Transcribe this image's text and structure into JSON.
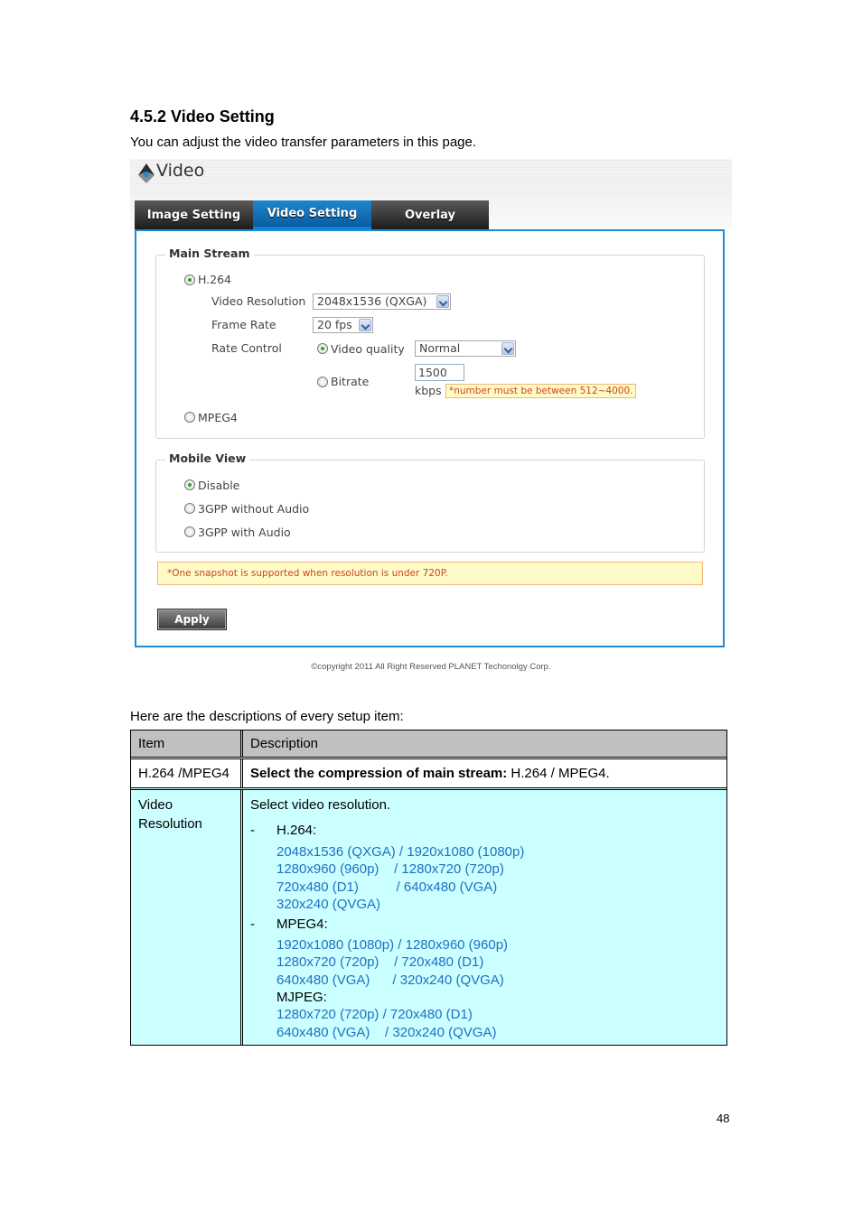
{
  "section": {
    "heading": "4.5.2 Video Setting",
    "intro": "You can adjust the video transfer parameters in this page."
  },
  "screenshot": {
    "app_title": "Video",
    "logo_icon": "planet-logo-icon",
    "tabs": [
      {
        "label": "Image Setting",
        "active": false
      },
      {
        "label": "Video Setting",
        "active": true
      },
      {
        "label": "Overlay",
        "active": false
      }
    ],
    "main_stream": {
      "legend": "Main Stream",
      "h264_label": "H.264",
      "h264_selected": true,
      "video_resolution_label": "Video Resolution",
      "video_resolution_value": "2048x1536 (QXGA)",
      "frame_rate_label": "Frame Rate",
      "frame_rate_value": "20 fps",
      "rate_control_label": "Rate Control",
      "video_quality_label": "Video quality",
      "video_quality_selected": true,
      "video_quality_value": "Normal",
      "bitrate_label": "Bitrate",
      "bitrate_selected": false,
      "bitrate_value": "1500",
      "bitrate_unit": "kbps",
      "bitrate_hint": "*number must be between 512~4000.",
      "mpeg4_label": "MPEG4",
      "mpeg4_selected": false
    },
    "mobile_view": {
      "legend": "Mobile View",
      "options": [
        {
          "label": "Disable",
          "selected": true
        },
        {
          "label": "3GPP without Audio",
          "selected": false
        },
        {
          "label": "3GPP with Audio",
          "selected": false
        }
      ]
    },
    "snapshot_note": "*One snapshot is supported when resolution is under 720P.",
    "apply_label": "Apply",
    "copyright": "©copyright 2011 All Right Reserved PLANET Techonolgy Corp.",
    "colors": {
      "accent": "#1e8ad6",
      "warning_text": "#d0441a",
      "warning_bg": "#fffbc8"
    }
  },
  "descriptions_lead": "Here are the descriptions of every setup item:",
  "table": {
    "headers": [
      "Item",
      "Description"
    ],
    "rows": [
      {
        "item": "H.264 /MPEG4",
        "desc_bold": "Select the compression of main stream:",
        "desc_rest": " H.264 / MPEG4."
      },
      {
        "item_lines": [
          "Video",
          "Resolution"
        ],
        "desc_intro": "Select video resolution.",
        "h264_label": "H.264:",
        "h264_lines": [
          "2048x1536 (QXGA) / 1920x1080 (1080p)",
          "1280x960 (960p)    / 1280x720 (720p)",
          "720x480 (D1)          / 640x480 (VGA)",
          "320x240 (QVGA)"
        ],
        "mpeg4_label": "MPEG4:",
        "mpeg4_lines": [
          "1920x1080 (1080p) / 1280x960 (960p)",
          "1280x720 (720p)    / 720x480 (D1)",
          "640x480 (VGA)      / 320x240 (QVGA)"
        ],
        "mjpeg_label": "MJPEG:",
        "mjpeg_lines": [
          "1280x720 (720p) / 720x480 (D1)",
          "640x480 (VGA)    / 320x240 (QVGA)"
        ],
        "bullet": "-"
      }
    ],
    "colors": {
      "header_bg": "#c0c0c0",
      "highlight_row_bg": "#ccffff",
      "resolution_text": "#1f6fc5"
    }
  },
  "page_number": "48"
}
